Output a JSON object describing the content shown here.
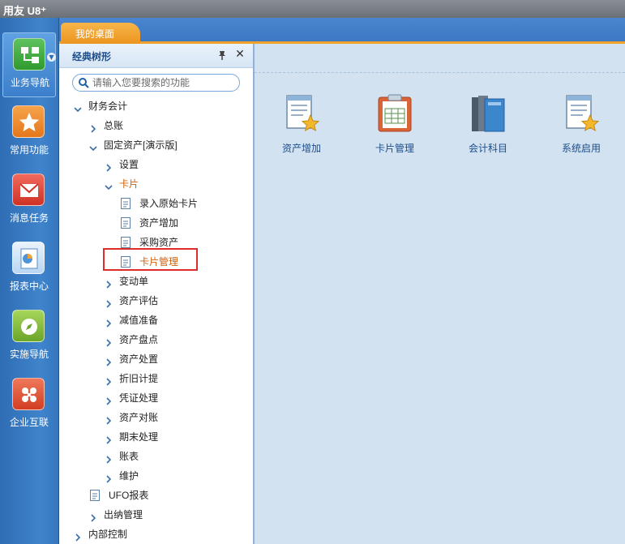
{
  "app": {
    "title": "用友 U8⁺"
  },
  "left_nav": [
    {
      "label": "业务导航",
      "icon": "business-navigation-icon",
      "active": true,
      "color": "#3aa83a"
    },
    {
      "label": "常用功能",
      "icon": "favorites-star-icon",
      "active": false,
      "color": "#ef8b2c"
    },
    {
      "label": "消息任务",
      "icon": "message-envelope-icon",
      "active": false,
      "color": "#e2483c"
    },
    {
      "label": "报表中心",
      "icon": "report-chart-icon",
      "active": false,
      "color": "#4d95d8"
    },
    {
      "label": "实施导航",
      "icon": "compass-icon",
      "active": false,
      "color": "#7cb530"
    },
    {
      "label": "企业互联",
      "icon": "enterprise-connect-icon",
      "active": false,
      "color": "#e0502c"
    }
  ],
  "tabs": [
    {
      "label": "我的桌面",
      "active": true
    }
  ],
  "tree_panel": {
    "title": "经典树形",
    "search_placeholder": "请输入您要搜索的功能",
    "items": [
      {
        "label": "财务会计",
        "type": "folder",
        "expanded": true
      },
      {
        "label": "总账",
        "type": "folder",
        "expanded": false
      },
      {
        "label": "固定资产[演示版]",
        "type": "folder",
        "expanded": true
      },
      {
        "label": "设置",
        "type": "folder",
        "expanded": false
      },
      {
        "label": "卡片",
        "type": "folder",
        "expanded": true,
        "highlighted": true
      },
      {
        "label": "录入原始卡片",
        "type": "leaf"
      },
      {
        "label": "资产增加",
        "type": "leaf"
      },
      {
        "label": "采购资产",
        "type": "leaf"
      },
      {
        "label": "卡片管理",
        "type": "leaf",
        "highlighted": true,
        "selected": true
      },
      {
        "label": "变动单",
        "type": "folder",
        "expanded": false
      },
      {
        "label": "资产评估",
        "type": "folder",
        "expanded": false
      },
      {
        "label": "减值准备",
        "type": "folder",
        "expanded": false
      },
      {
        "label": "资产盘点",
        "type": "folder",
        "expanded": false
      },
      {
        "label": "资产处置",
        "type": "folder",
        "expanded": false
      },
      {
        "label": "折旧计提",
        "type": "folder",
        "expanded": false
      },
      {
        "label": "凭证处理",
        "type": "folder",
        "expanded": false
      },
      {
        "label": "资产对账",
        "type": "folder",
        "expanded": false
      },
      {
        "label": "期末处理",
        "type": "folder",
        "expanded": false
      },
      {
        "label": "账表",
        "type": "folder",
        "expanded": false
      },
      {
        "label": "维护",
        "type": "folder",
        "expanded": false
      },
      {
        "label": "UFO报表",
        "type": "leaf"
      },
      {
        "label": "出纳管理",
        "type": "folder",
        "expanded": false
      },
      {
        "label": "内部控制",
        "type": "folder",
        "expanded": false
      }
    ]
  },
  "desktop_icons": [
    {
      "label": "资产增加",
      "icon": "document-star-icon"
    },
    {
      "label": "卡片管理",
      "icon": "clipboard-card-icon"
    },
    {
      "label": "会计科目",
      "icon": "books-icon"
    },
    {
      "label": "系统启用",
      "icon": "document-star-icon"
    }
  ],
  "colors": {
    "highlight_text": "#d1600d",
    "highlight_box": "#e02b2b",
    "accent_tab": "#f0a12b",
    "nav_blue": "#3676bf"
  }
}
